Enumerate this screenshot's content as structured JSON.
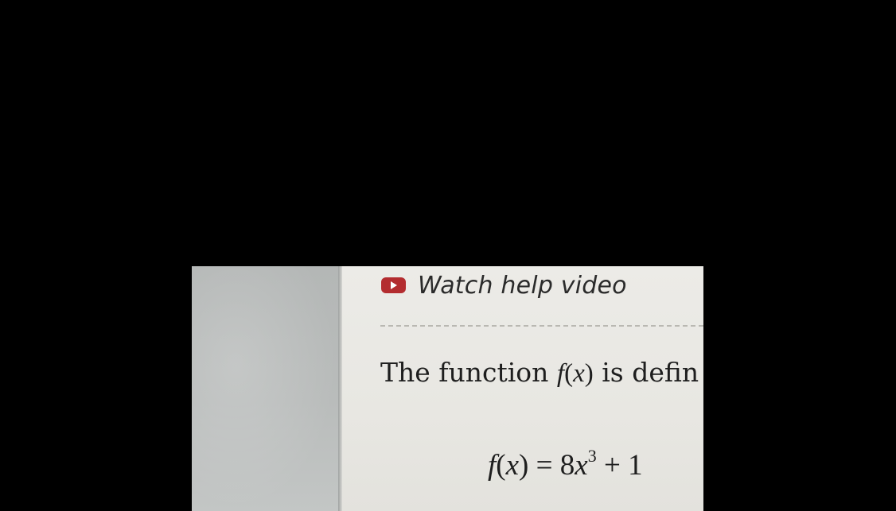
{
  "help": {
    "label": "Watch help video",
    "icon": "play-icon",
    "icon_color": "#b32c2f"
  },
  "question": {
    "intro_start": "The function ",
    "function_name": "f",
    "open_paren": "(",
    "variable": "x",
    "close_paren": ")",
    "intro_end": " is defin"
  },
  "equation": {
    "lhs_function": "f",
    "lhs_open": "(",
    "lhs_variable": "x",
    "lhs_close": ")",
    "equals": " = ",
    "coefficient": "8",
    "variable": "x",
    "exponent": "3",
    "plus": " + ",
    "constant_partial": "1"
  }
}
